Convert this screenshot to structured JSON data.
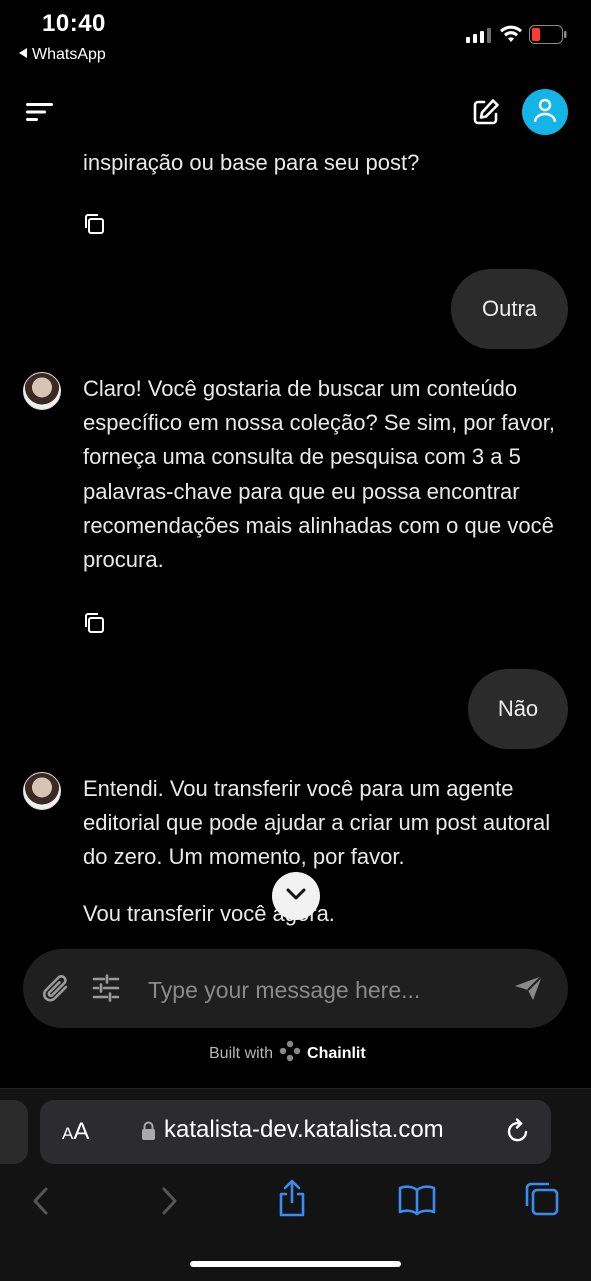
{
  "status_bar": {
    "time": "10:40",
    "back_app": "WhatsApp"
  },
  "header": {
    "menu_icon": "menu-icon",
    "edit_icon": "edit-icon",
    "user_icon": "user-icon",
    "accent_color": "#14b4e6"
  },
  "messages": [
    {
      "role": "bot",
      "text": "inspiração ou base para seu post?"
    },
    {
      "role": "user",
      "text": "Outra"
    },
    {
      "role": "bot",
      "text": "Claro! Você gostaria de buscar um conteúdo específico em nossa coleção? Se sim, por favor, forneça uma consulta de pesquisa com 3 a 5 palavras-chave para que eu possa encontrar recomendações mais alinhadas com o que você procura."
    },
    {
      "role": "user",
      "text": "Não"
    },
    {
      "role": "bot",
      "text": "Entendi. Vou transferir você para um agente editorial que pode ajudar a criar um post autoral do zero. Um momento, por favor.",
      "text2": "Vou transferir você agora."
    }
  ],
  "composer": {
    "placeholder": "Type your message here...",
    "built_with": "Built with",
    "brand": "Chainlit"
  },
  "browser": {
    "aa_label_small": "A",
    "aa_label_big": "A",
    "url": "katalista-dev.katalista.com",
    "tint_color": "#3a8cf0"
  }
}
